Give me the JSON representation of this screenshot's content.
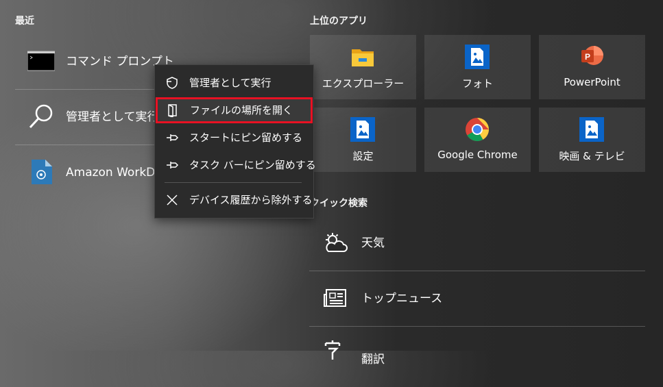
{
  "recent": {
    "title": "最近",
    "items": [
      {
        "label": "コマンド プロンプト",
        "icon": "cmd-icon"
      },
      {
        "label": "管理者として実行",
        "icon": "search-icon"
      },
      {
        "label": "Amazon WorkD",
        "icon": "workdocs-icon"
      }
    ]
  },
  "top_apps": {
    "title": "上位のアプリ",
    "tiles": [
      {
        "label": "エクスプローラー",
        "icon": "folder-icon"
      },
      {
        "label": "フォト",
        "icon": "photos-icon"
      },
      {
        "label": "PowerPoint",
        "icon": "powerpoint-icon"
      },
      {
        "label": "設定",
        "icon": "settings-icon"
      },
      {
        "label": "Google Chrome",
        "icon": "chrome-icon"
      },
      {
        "label": "映画 & テレビ",
        "icon": "movies-icon"
      }
    ]
  },
  "quick_search": {
    "title": "クイック検索",
    "items": [
      {
        "label": "天気",
        "icon": "weather-icon"
      },
      {
        "label": "トップニュース",
        "icon": "news-icon"
      },
      {
        "label": "翻訳",
        "icon": "translate-icon"
      }
    ]
  },
  "context_menu": {
    "items": [
      {
        "label": "管理者として実行",
        "icon": "shield-icon"
      },
      {
        "label": "ファイルの場所を開く",
        "icon": "open-file-location-icon",
        "selected": true
      },
      {
        "label": "スタートにピン留めする",
        "icon": "pin-icon"
      },
      {
        "label": "タスク バーにピン留めする",
        "icon": "pin-icon"
      },
      {
        "label": "デバイス履歴から除外する",
        "icon": "close-icon"
      }
    ]
  },
  "colors": {
    "accent": "#0078d4",
    "highlight_border": "#e81123"
  }
}
